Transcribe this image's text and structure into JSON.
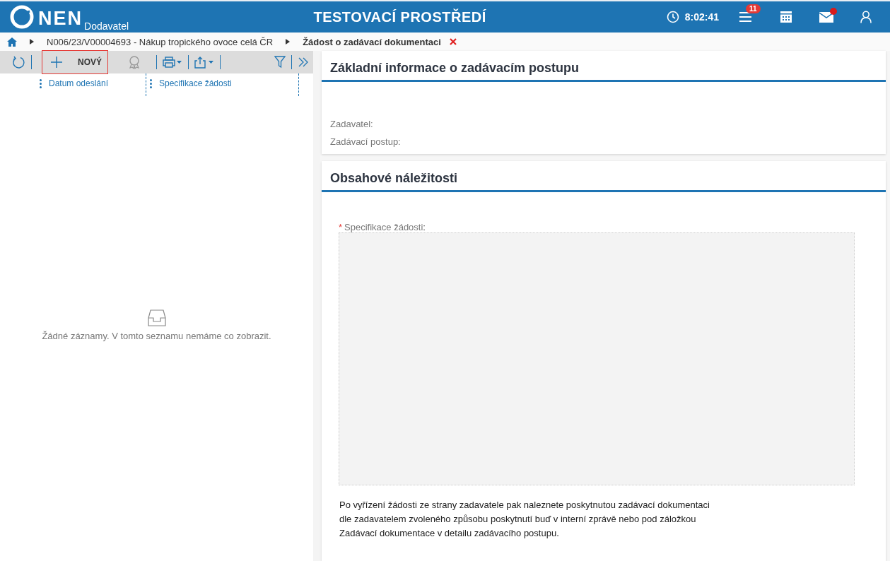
{
  "header": {
    "logo": "NEN",
    "subtitle": "Dodavatel",
    "title": "TESTOVACÍ PROSTŘEDÍ",
    "clock": "8:02:41",
    "menu_badge": "11",
    "mail_unread": true
  },
  "breadcrumb": {
    "items": [
      "N006/23/V00004693 - Nákup tropického ovoce celá ČR",
      "Žádost o zadávací dokumentaci"
    ]
  },
  "toolbar": {
    "new_button": {
      "label": "NOVÝ",
      "focused": true
    }
  },
  "list": {
    "columns": [
      "Datum odeslání",
      "Specifikace žádosti"
    ],
    "empty_text": "Žádné záznamy. V tomto seznamu nemáme co zobrazit."
  },
  "sections": [
    {
      "title": "Základní informace o zadávacím postupu",
      "fields": [
        "Zadavatel:",
        "Zadávací postup:"
      ]
    },
    {
      "title": "Obsahové náležitosti",
      "textarea": {
        "label": "Specifikace žádosti",
        "required": true,
        "required_mark": "*",
        "label_suffix": ":"
      },
      "note": "Po vyřízení žádosti ze strany zadavatele pak naleznete poskytnutou zadávací dokumentaci dle zadavatelem zvoleného způsobu poskytnutí buď v interní zprávě nebo pod záložkou Zadávací dokumentace v detailu zadávacího postupu."
    }
  ]
}
